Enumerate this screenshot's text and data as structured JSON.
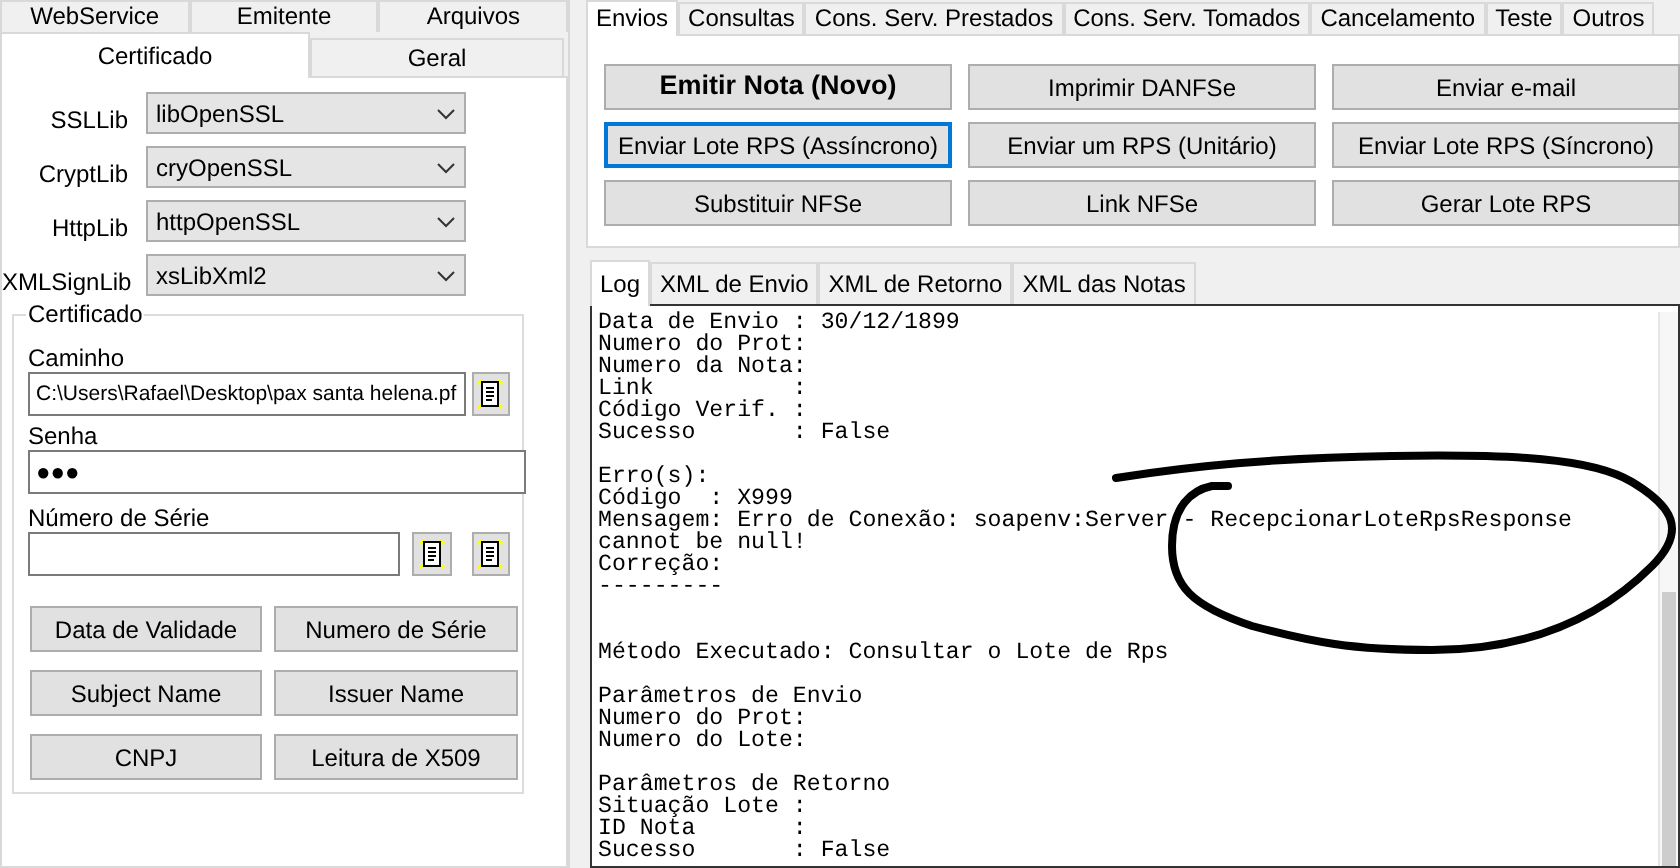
{
  "left_tabs_back": [
    {
      "label": "WebService"
    },
    {
      "label": "Emitente"
    },
    {
      "label": "Arquivos"
    }
  ],
  "left_tabs": [
    {
      "label": "Certificado",
      "selected": true
    },
    {
      "label": "Geral",
      "selected": false
    }
  ],
  "libs": [
    {
      "label": "SSLLib",
      "value": "libOpenSSL"
    },
    {
      "label": "CryptLib",
      "value": "cryOpenSSL"
    },
    {
      "label": "HttpLib",
      "value": "httpOpenSSL"
    },
    {
      "label": "XMLSignLib",
      "value": "xsLibXml2"
    }
  ],
  "certificado": {
    "title": "Certificado",
    "caminho": {
      "label": "Caminho",
      "value": "C:\\Users\\Rafael\\Desktop\\pax santa helena.pf"
    },
    "senha": {
      "label": "Senha",
      "value": "●●●"
    },
    "numero_serie": {
      "label": "Número de Série"
    },
    "buttons": [
      "Data de Validade",
      "Numero de Série",
      "Subject Name",
      "Issuer Name",
      "CNPJ",
      "Leitura de X509"
    ]
  },
  "top_tabs": [
    {
      "label": "Envios",
      "selected": true
    },
    {
      "label": "Consultas",
      "selected": false
    },
    {
      "label": "Cons. Serv. Prestados",
      "selected": false
    },
    {
      "label": "Cons. Serv. Tomados",
      "selected": false
    },
    {
      "label": "Cancelamento",
      "selected": false
    },
    {
      "label": "Teste",
      "selected": false
    },
    {
      "label": "Outros",
      "selected": false
    }
  ],
  "actions": [
    {
      "label": "Emitir Nota (Novo)",
      "bold": true,
      "focused": false
    },
    {
      "label": "Imprimir DANFSe",
      "bold": false,
      "focused": false
    },
    {
      "label": "Enviar e-mail",
      "bold": false,
      "focused": false
    },
    {
      "label": "Enviar Lote RPS (Assíncrono)",
      "bold": false,
      "focused": true
    },
    {
      "label": "Enviar um RPS (Unitário)",
      "bold": false,
      "focused": false
    },
    {
      "label": "Enviar Lote RPS (Síncrono)",
      "bold": false,
      "focused": false
    },
    {
      "label": "Substituir NFSe",
      "bold": false,
      "focused": false
    },
    {
      "label": "Link NFSe",
      "bold": false,
      "focused": false
    },
    {
      "label": "Gerar Lote RPS",
      "bold": false,
      "focused": false
    }
  ],
  "log_tabs": [
    {
      "label": "Log",
      "selected": true
    },
    {
      "label": "XML de Envio",
      "selected": false
    },
    {
      "label": "XML de Retorno",
      "selected": false
    },
    {
      "label": "XML das Notas",
      "selected": false
    }
  ],
  "log_lines": [
    {
      "kind": "text",
      "text": "Data de Envio : 30/12/1899"
    },
    {
      "kind": "text",
      "text": "Numero do Prot:"
    },
    {
      "kind": "text",
      "text": "Numero da Nota:"
    },
    {
      "kind": "text",
      "text": "Link          :"
    },
    {
      "kind": "text",
      "text": "Código Verif. :"
    },
    {
      "kind": "text",
      "text": "Sucesso       : False"
    },
    {
      "kind": "blank"
    },
    {
      "kind": "text",
      "text": "Erro(s):"
    },
    {
      "kind": "text",
      "text": "Código  : X999"
    },
    {
      "kind": "text",
      "text": "Mensagem: Erro de Conexão: soapenv:Server - RecepcionarLoteRpsResponse"
    },
    {
      "kind": "text",
      "text": "cannot be null!"
    },
    {
      "kind": "text",
      "text": "Correção:"
    },
    {
      "kind": "text",
      "text": "---------"
    },
    {
      "kind": "blank"
    },
    {
      "kind": "blank"
    },
    {
      "kind": "text",
      "text": "Método Executado: Consultar o Lote de Rps"
    },
    {
      "kind": "blank"
    },
    {
      "kind": "text",
      "text": "Parâmetros de Envio"
    },
    {
      "kind": "text",
      "text": "Numero do Prot:"
    },
    {
      "kind": "text",
      "text": "Numero do Lote:"
    },
    {
      "kind": "blank"
    },
    {
      "kind": "text",
      "text": "Parâmetros de Retorno"
    },
    {
      "kind": "text",
      "text": "Situação Lote :"
    },
    {
      "kind": "text",
      "text": "ID Nota       :"
    },
    {
      "kind": "text",
      "text": "Sucesso       : False"
    }
  ]
}
